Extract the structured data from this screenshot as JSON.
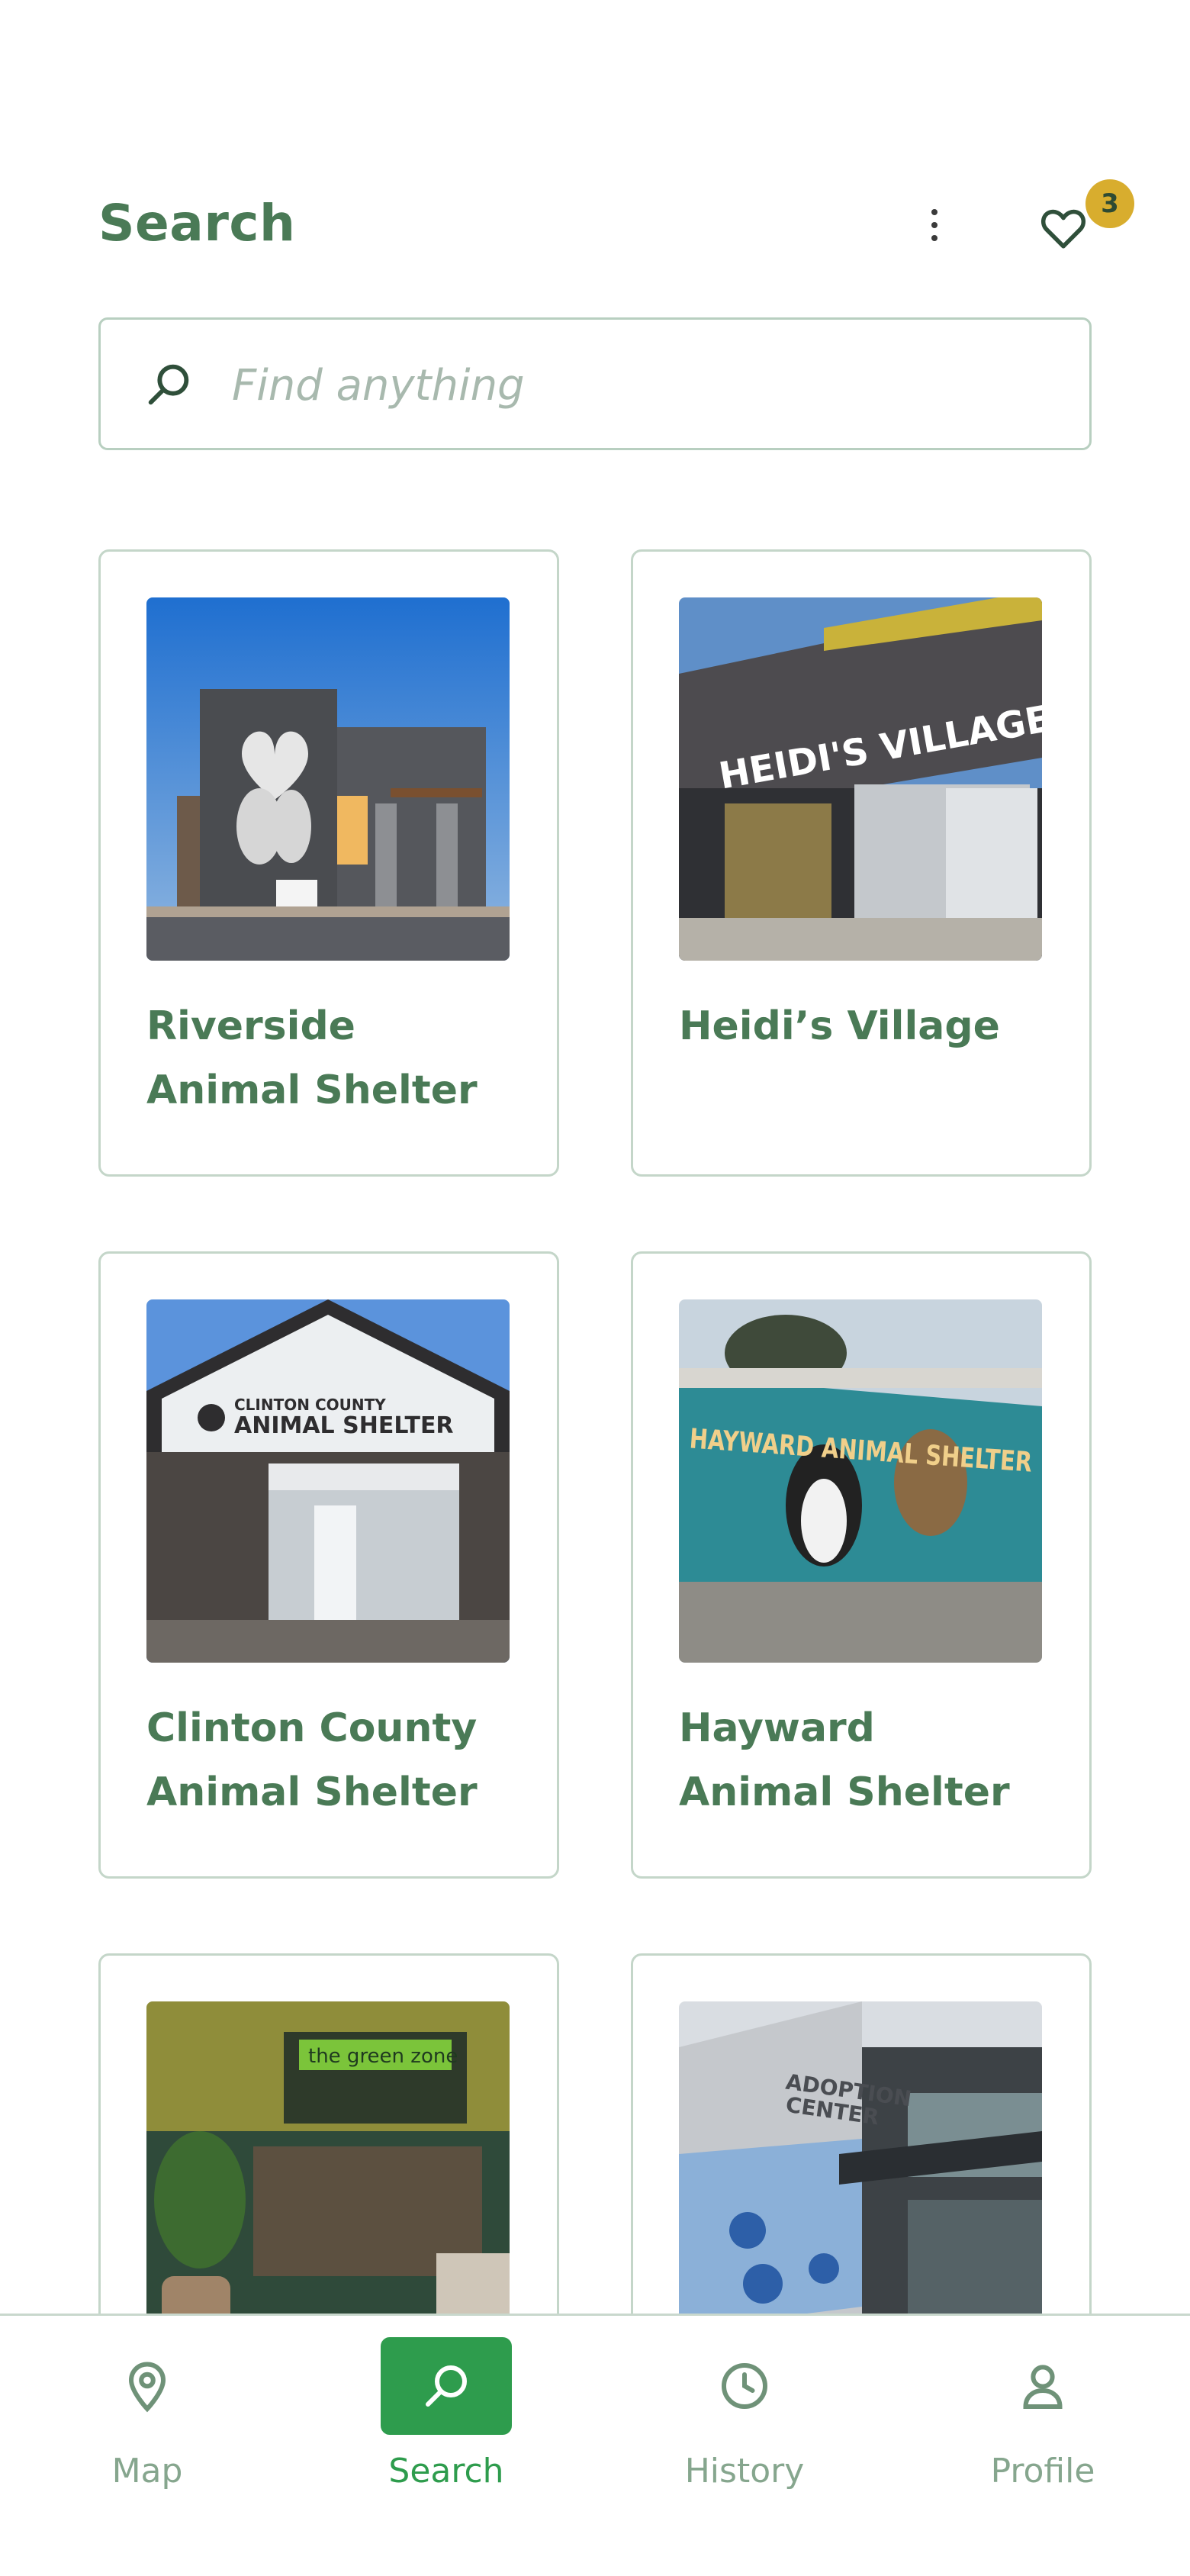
{
  "header": {
    "title": "Search",
    "favorites_count": "3"
  },
  "search": {
    "placeholder": "Find anything",
    "value": ""
  },
  "results": [
    {
      "name": "Riverside\nAnimal Shelter",
      "line1": "Riverside",
      "line2": "Animal Shelter"
    },
    {
      "name": "Heidi’s Village",
      "line1": "Heidi’s Village",
      "line2": ""
    },
    {
      "name": "Clinton County\nAnimal Shelter",
      "line1": "Clinton County",
      "line2": "Animal Shelter"
    },
    {
      "name": "Hayward\nAnimal Shelter",
      "line1": "Hayward",
      "line2": "Animal Shelter"
    },
    {
      "name": "",
      "line1": "",
      "line2": ""
    },
    {
      "name": "",
      "line1": "",
      "line2": ""
    }
  ],
  "image_text": {
    "heidis_sign": "HEIDI'S VILLAGE",
    "clinton_sign_1": "CLINTON COUNTY",
    "clinton_sign_2": "ANIMAL SHELTER",
    "hayward_sign": "HAYWARD ANIMAL SHELTER",
    "green_zone_sign": "the green zone",
    "adoption_sign_1": "ADOPTION",
    "adoption_sign_2": "CENTER"
  },
  "nav": {
    "items": [
      {
        "label": "Map",
        "icon": "map-pin-icon"
      },
      {
        "label": "Search",
        "icon": "search-icon"
      },
      {
        "label": "History",
        "icon": "clock-icon"
      },
      {
        "label": "Profile",
        "icon": "person-icon"
      }
    ],
    "active": "Search"
  },
  "colors": {
    "brand_green": "#4a7a56",
    "active_green": "#2e9c4d",
    "badge_yellow": "#d8ad2e",
    "border": "#c4d6c9"
  }
}
